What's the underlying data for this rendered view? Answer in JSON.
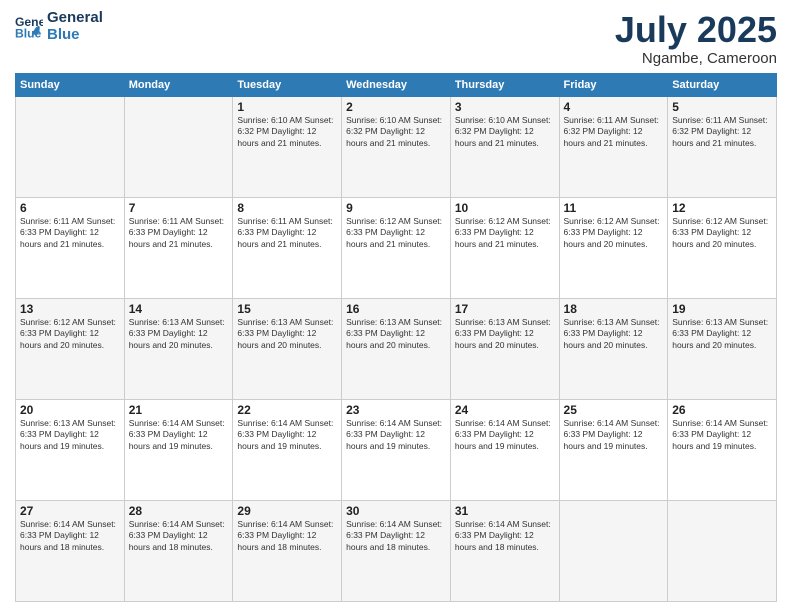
{
  "logo": {
    "line1": "General",
    "line2": "Blue"
  },
  "header": {
    "month": "July 2025",
    "location": "Ngambe, Cameroon"
  },
  "weekdays": [
    "Sunday",
    "Monday",
    "Tuesday",
    "Wednesday",
    "Thursday",
    "Friday",
    "Saturday"
  ],
  "weeks": [
    [
      {
        "day": "",
        "info": ""
      },
      {
        "day": "",
        "info": ""
      },
      {
        "day": "1",
        "info": "Sunrise: 6:10 AM\nSunset: 6:32 PM\nDaylight: 12 hours and 21 minutes."
      },
      {
        "day": "2",
        "info": "Sunrise: 6:10 AM\nSunset: 6:32 PM\nDaylight: 12 hours and 21 minutes."
      },
      {
        "day": "3",
        "info": "Sunrise: 6:10 AM\nSunset: 6:32 PM\nDaylight: 12 hours and 21 minutes."
      },
      {
        "day": "4",
        "info": "Sunrise: 6:11 AM\nSunset: 6:32 PM\nDaylight: 12 hours and 21 minutes."
      },
      {
        "day": "5",
        "info": "Sunrise: 6:11 AM\nSunset: 6:32 PM\nDaylight: 12 hours and 21 minutes."
      }
    ],
    [
      {
        "day": "6",
        "info": "Sunrise: 6:11 AM\nSunset: 6:33 PM\nDaylight: 12 hours and 21 minutes."
      },
      {
        "day": "7",
        "info": "Sunrise: 6:11 AM\nSunset: 6:33 PM\nDaylight: 12 hours and 21 minutes."
      },
      {
        "day": "8",
        "info": "Sunrise: 6:11 AM\nSunset: 6:33 PM\nDaylight: 12 hours and 21 minutes."
      },
      {
        "day": "9",
        "info": "Sunrise: 6:12 AM\nSunset: 6:33 PM\nDaylight: 12 hours and 21 minutes."
      },
      {
        "day": "10",
        "info": "Sunrise: 6:12 AM\nSunset: 6:33 PM\nDaylight: 12 hours and 21 minutes."
      },
      {
        "day": "11",
        "info": "Sunrise: 6:12 AM\nSunset: 6:33 PM\nDaylight: 12 hours and 20 minutes."
      },
      {
        "day": "12",
        "info": "Sunrise: 6:12 AM\nSunset: 6:33 PM\nDaylight: 12 hours and 20 minutes."
      }
    ],
    [
      {
        "day": "13",
        "info": "Sunrise: 6:12 AM\nSunset: 6:33 PM\nDaylight: 12 hours and 20 minutes."
      },
      {
        "day": "14",
        "info": "Sunrise: 6:13 AM\nSunset: 6:33 PM\nDaylight: 12 hours and 20 minutes."
      },
      {
        "day": "15",
        "info": "Sunrise: 6:13 AM\nSunset: 6:33 PM\nDaylight: 12 hours and 20 minutes."
      },
      {
        "day": "16",
        "info": "Sunrise: 6:13 AM\nSunset: 6:33 PM\nDaylight: 12 hours and 20 minutes."
      },
      {
        "day": "17",
        "info": "Sunrise: 6:13 AM\nSunset: 6:33 PM\nDaylight: 12 hours and 20 minutes."
      },
      {
        "day": "18",
        "info": "Sunrise: 6:13 AM\nSunset: 6:33 PM\nDaylight: 12 hours and 20 minutes."
      },
      {
        "day": "19",
        "info": "Sunrise: 6:13 AM\nSunset: 6:33 PM\nDaylight: 12 hours and 20 minutes."
      }
    ],
    [
      {
        "day": "20",
        "info": "Sunrise: 6:13 AM\nSunset: 6:33 PM\nDaylight: 12 hours and 19 minutes."
      },
      {
        "day": "21",
        "info": "Sunrise: 6:14 AM\nSunset: 6:33 PM\nDaylight: 12 hours and 19 minutes."
      },
      {
        "day": "22",
        "info": "Sunrise: 6:14 AM\nSunset: 6:33 PM\nDaylight: 12 hours and 19 minutes."
      },
      {
        "day": "23",
        "info": "Sunrise: 6:14 AM\nSunset: 6:33 PM\nDaylight: 12 hours and 19 minutes."
      },
      {
        "day": "24",
        "info": "Sunrise: 6:14 AM\nSunset: 6:33 PM\nDaylight: 12 hours and 19 minutes."
      },
      {
        "day": "25",
        "info": "Sunrise: 6:14 AM\nSunset: 6:33 PM\nDaylight: 12 hours and 19 minutes."
      },
      {
        "day": "26",
        "info": "Sunrise: 6:14 AM\nSunset: 6:33 PM\nDaylight: 12 hours and 19 minutes."
      }
    ],
    [
      {
        "day": "27",
        "info": "Sunrise: 6:14 AM\nSunset: 6:33 PM\nDaylight: 12 hours and 18 minutes."
      },
      {
        "day": "28",
        "info": "Sunrise: 6:14 AM\nSunset: 6:33 PM\nDaylight: 12 hours and 18 minutes."
      },
      {
        "day": "29",
        "info": "Sunrise: 6:14 AM\nSunset: 6:33 PM\nDaylight: 12 hours and 18 minutes."
      },
      {
        "day": "30",
        "info": "Sunrise: 6:14 AM\nSunset: 6:33 PM\nDaylight: 12 hours and 18 minutes."
      },
      {
        "day": "31",
        "info": "Sunrise: 6:14 AM\nSunset: 6:33 PM\nDaylight: 12 hours and 18 minutes."
      },
      {
        "day": "",
        "info": ""
      },
      {
        "day": "",
        "info": ""
      }
    ]
  ]
}
